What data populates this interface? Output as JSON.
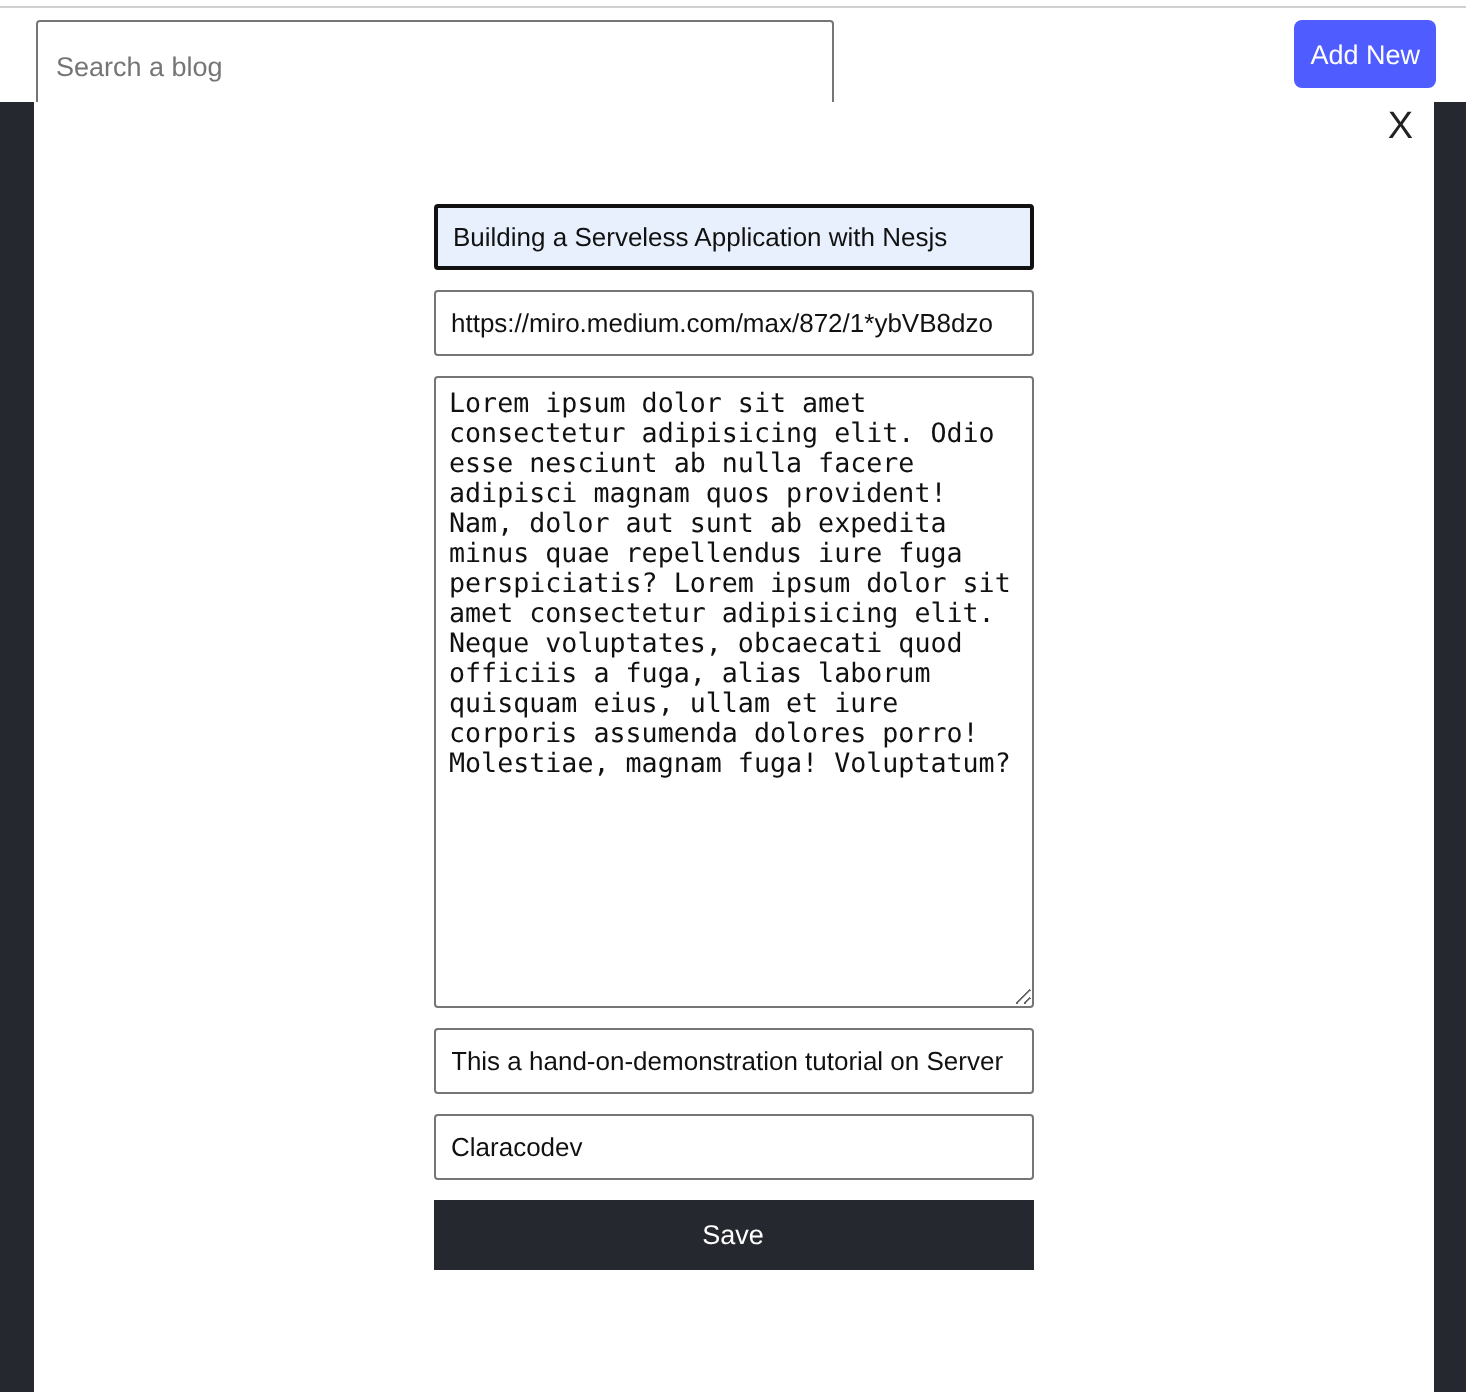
{
  "header": {
    "search": {
      "placeholder": "Search a blog"
    },
    "add_button": "Add New"
  },
  "modal": {
    "close": "X",
    "fields": [
      {
        "kind": "input",
        "value": "Building a Serveless Application with Nesjs",
        "focused": true
      },
      {
        "kind": "input",
        "value": "https://miro.medium.com/max/872/1*ybVB8dzo",
        "focused": false
      },
      {
        "kind": "textarea",
        "value": "Lorem ipsum dolor sit amet consectetur adipisicing elit. Odio esse nesciunt ab nulla facere adipisci magnam quos provident! Nam, dolor aut sunt ab expedita minus quae repellendus iure fuga perspiciatis? Lorem ipsum dolor sit amet consectetur adipisicing elit. Neque voluptates, obcaecati quod officiis a fuga, alias laborum quisquam eius, ullam et iure corporis assumenda dolores porro! Molestiae, magnam fuga! Voluptatum?",
        "focused": false
      },
      {
        "kind": "input",
        "value": "This a hand-on-demonstration tutorial on Server",
        "focused": false
      },
      {
        "kind": "input",
        "value": "Claracodev",
        "focused": false
      }
    ],
    "save_button": "Save"
  }
}
